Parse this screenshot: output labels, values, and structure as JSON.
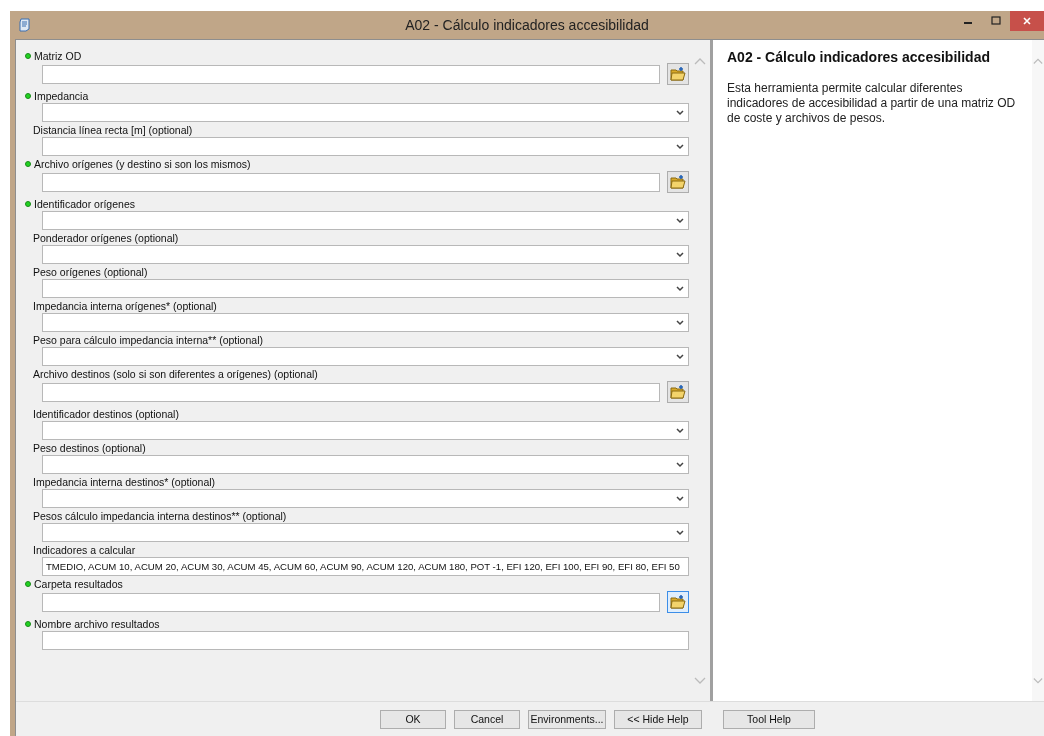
{
  "window": {
    "title": "A02 - Cálculo indicadores accesibilidad"
  },
  "parameters": [
    {
      "label": "Matriz OD",
      "kind": "file",
      "required": true,
      "focused": false
    },
    {
      "label": "Impedancia",
      "kind": "dropdown",
      "required": true
    },
    {
      "label": "Distancia línea recta [m] (optional)",
      "kind": "dropdown",
      "required": false
    },
    {
      "label": "Archivo orígenes (y destino si son los mismos)",
      "kind": "file",
      "required": true,
      "focused": false
    },
    {
      "label": "Identificador orígenes",
      "kind": "dropdown",
      "required": true
    },
    {
      "label": "Ponderador orígenes (optional)",
      "kind": "dropdown",
      "required": false
    },
    {
      "label": "Peso orígenes (optional)",
      "kind": "dropdown",
      "required": false
    },
    {
      "label": "Impedancia interna orígenes* (optional)",
      "kind": "dropdown",
      "required": false
    },
    {
      "label": "Peso para cálculo impedancia interna** (optional)",
      "kind": "dropdown",
      "required": false
    },
    {
      "label": "Archivo destinos (solo si son diferentes a orígenes) (optional)",
      "kind": "file",
      "required": false,
      "focused": false
    },
    {
      "label": "Identificador destinos (optional)",
      "kind": "dropdown",
      "required": false
    },
    {
      "label": "Peso destinos (optional)",
      "kind": "dropdown",
      "required": false
    },
    {
      "label": "Impedancia interna destinos* (optional)",
      "kind": "dropdown",
      "required": false
    },
    {
      "label": "Pesos cálculo impedancia interna destinos** (optional)",
      "kind": "dropdown",
      "required": false
    },
    {
      "label": "Indicadores a calcular",
      "kind": "text",
      "required": false,
      "value": "TMEDIO, ACUM 10, ACUM 20, ACUM 30, ACUM 45, ACUM 60, ACUM 90, ACUM 120, ACUM 180, POT -1, EFI 120, EFI 100, EFI 90, EFI 80, EFI 50"
    },
    {
      "label": "Carpeta resultados",
      "kind": "file",
      "required": true,
      "focused": true
    },
    {
      "label": "Nombre archivo resultados",
      "kind": "text",
      "required": true
    }
  ],
  "help": {
    "title": "A02 - Cálculo indicadores accesibilidad",
    "text": "Esta herramienta permite calcular diferentes indicadores de accesibilidad a partir de una matriz OD de coste y archivos de pesos."
  },
  "buttons": [
    "OK",
    "Cancel",
    "Environments...",
    "<< Hide Help",
    "Tool Help"
  ]
}
